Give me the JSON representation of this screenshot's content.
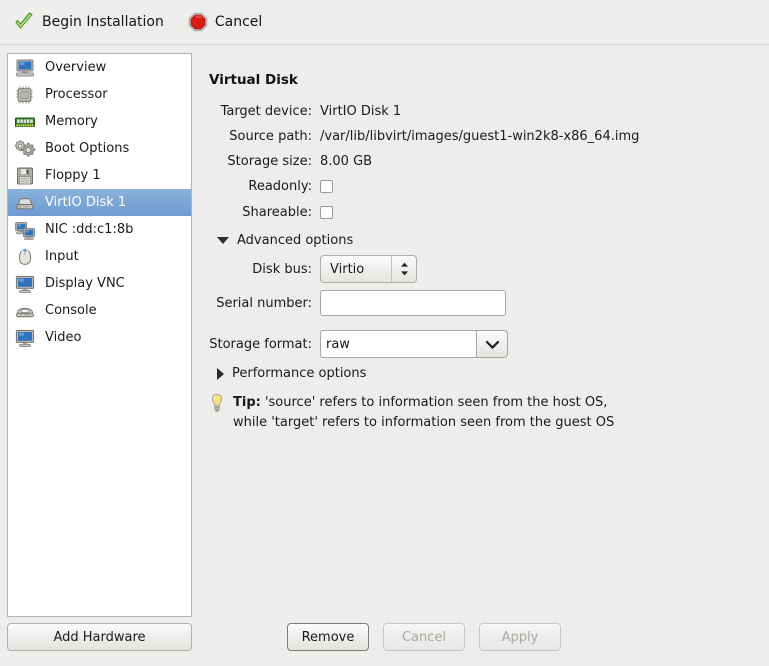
{
  "toolbar": {
    "begin_installation_label": "Begin Installation",
    "begin_installation_icon": "green-check-icon",
    "cancel_label": "Cancel",
    "cancel_icon": "red-stop-icon"
  },
  "sidebar": {
    "items": [
      {
        "label": "Overview",
        "icon": "computer-icon",
        "selected": false
      },
      {
        "label": "Processor",
        "icon": "cpu-chip-icon",
        "selected": false
      },
      {
        "label": "Memory",
        "icon": "memory-ram-icon",
        "selected": false
      },
      {
        "label": "Boot Options",
        "icon": "gears-icon",
        "selected": false
      },
      {
        "label": "Floppy 1",
        "icon": "floppy-disk-icon",
        "selected": false
      },
      {
        "label": "VirtIO Disk 1",
        "icon": "hard-disk-icon",
        "selected": true
      },
      {
        "label": "NIC :dd:c1:8b",
        "icon": "network-icon",
        "selected": false
      },
      {
        "label": "Input",
        "icon": "mouse-icon",
        "selected": false
      },
      {
        "label": "Display VNC",
        "icon": "display-icon",
        "selected": false
      },
      {
        "label": "Console",
        "icon": "console-icon",
        "selected": false
      },
      {
        "label": "Video",
        "icon": "video-card-icon",
        "selected": false
      }
    ],
    "add_hardware_label": "Add Hardware"
  },
  "detail": {
    "title": "Virtual Disk",
    "target_device_label": "Target device:",
    "target_device_value": "VirtIO Disk 1",
    "source_path_label": "Source path:",
    "source_path_value": "/var/lib/libvirt/images/guest1-win2k8-x86_64.img",
    "storage_size_label": "Storage size:",
    "storage_size_value": "8.00 GB",
    "readonly_label": "Readonly:",
    "readonly_checked": false,
    "shareable_label": "Shareable:",
    "shareable_checked": false,
    "advanced_options_label": "Advanced options",
    "advanced_options_expanded": true,
    "disk_bus_label": "Disk bus:",
    "disk_bus_value": "Virtio",
    "serial_number_label": "Serial number:",
    "serial_number_value": "",
    "serial_number_placeholder": "",
    "storage_format_label": "Storage format:",
    "storage_format_value": "raw",
    "performance_options_label": "Performance options",
    "performance_options_expanded": false,
    "tip_prefix": "Tip:",
    "tip_line1": " 'source' refers to information seen from the host OS,",
    "tip_line2": "while 'target' refers to information seen from the guest OS",
    "tip_icon": "lightbulb-icon"
  },
  "footer": {
    "remove_label": "Remove",
    "cancel_label": "Cancel",
    "apply_label": "Apply",
    "remove_enabled": true,
    "cancel_enabled": false,
    "apply_enabled": false
  },
  "colors": {
    "selection_blue": "#7ba3d6",
    "window_background": "#ededeb",
    "list_background": "#ffffff"
  }
}
